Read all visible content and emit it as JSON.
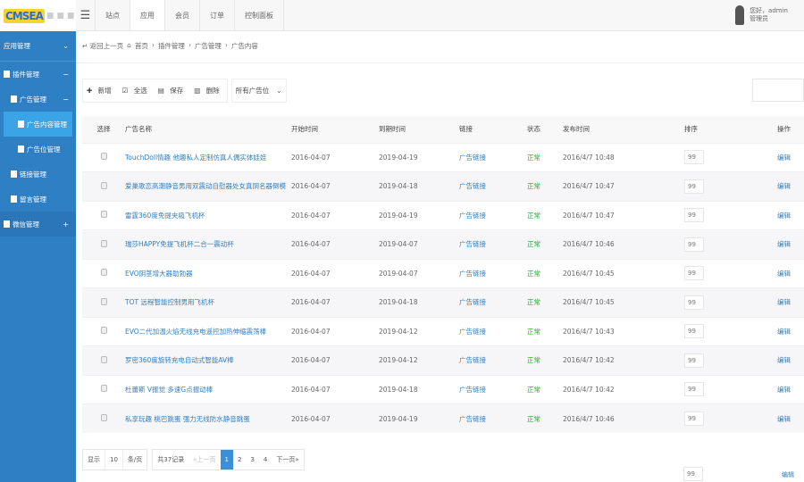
{
  "logo": "CMSEA",
  "topnav": {
    "items": [
      "站点",
      "应用",
      "会员",
      "订单",
      "控制面板"
    ],
    "active": 1
  },
  "user": {
    "greeting": "您好，admin",
    "role": "管理员"
  },
  "sidebar": {
    "items": [
      {
        "label": "应用管理",
        "icon": "chevron-down"
      },
      {
        "label": "插件管理",
        "icon": "minus"
      },
      {
        "label": "广告管理",
        "icon": "minus"
      },
      {
        "label": "广告内容管理"
      },
      {
        "label": "广告位管理"
      },
      {
        "label": "链接管理"
      },
      {
        "label": "留言管理"
      },
      {
        "label": "微信管理",
        "icon": "plus"
      }
    ]
  },
  "breadcrumb": {
    "back": "返回上一页",
    "items": [
      "首页",
      "插件管理",
      "广告管理",
      "广告内容"
    ]
  },
  "toolbar": {
    "add": "新增",
    "select_all": "全选",
    "save": "保存",
    "delete": "删除",
    "position_select": "所有广告位"
  },
  "table": {
    "headers": [
      "选择",
      "广告名称",
      "开始时间",
      "到期时间",
      "链接",
      "状态",
      "发布时间",
      "排序",
      "操作"
    ],
    "rows": [
      {
        "name": "TouchDoll情趣 他趣私人定制仿真人偶实体娃娃",
        "start": "2016-04-07",
        "end": "2019-04-19",
        "link": "广告链接",
        "status": "正常",
        "published": "2016/4/7 10:48",
        "order": "99",
        "action": "编辑"
      },
      {
        "name": "爱巢歌恋高潮静音男用双震动自慰器处女真阴名器倒模",
        "start": "2016-04-07",
        "end": "2019-04-18",
        "link": "广告链接",
        "status": "正常",
        "published": "2016/4/7 10:47",
        "order": "99",
        "action": "编辑"
      },
      {
        "name": "雷霆360度免提夹吸飞机杯",
        "start": "2016-04-07",
        "end": "2019-04-19",
        "link": "广告链接",
        "status": "正常",
        "published": "2016/4/7 10:47",
        "order": "99",
        "action": "编辑"
      },
      {
        "name": "瑞莎HAPPY免提飞机杯二合一震动杯",
        "start": "2016-04-07",
        "end": "2019-04-07",
        "link": "广告链接",
        "status": "正常",
        "published": "2016/4/7 10:46",
        "order": "99",
        "action": "编辑"
      },
      {
        "name": "EVO阴茎增大器助勃器",
        "start": "2016-04-07",
        "end": "2019-04-07",
        "link": "广告链接",
        "status": "正常",
        "published": "2016/4/7 10:45",
        "order": "99",
        "action": "编辑"
      },
      {
        "name": "TOT 远程智能控制男用飞机杯",
        "start": "2016-04-07",
        "end": "2019-04-18",
        "link": "广告链接",
        "status": "正常",
        "published": "2016/4/7 10:45",
        "order": "99",
        "action": "编辑"
      },
      {
        "name": "EVO二代加温火焰无线充电遥控加热伸缩震荡棒",
        "start": "2016-04-07",
        "end": "2019-04-12",
        "link": "广告链接",
        "status": "正常",
        "published": "2016/4/7 10:43",
        "order": "99",
        "action": "编辑"
      },
      {
        "name": "罗密360度旋转充电自动式智能AV棒",
        "start": "2016-04-07",
        "end": "2019-04-12",
        "link": "广告链接",
        "status": "正常",
        "published": "2016/4/7 10:42",
        "order": "99",
        "action": "编辑"
      },
      {
        "name": "杜蕾斯 V振觉 多速G点振动棒",
        "start": "2016-04-07",
        "end": "2019-04-18",
        "link": "广告链接",
        "status": "正常",
        "published": "2016/4/7 10:42",
        "order": "99",
        "action": "编辑"
      },
      {
        "name": "私享玩趣 桃巴跳蛋 强力无线防水静音跳蛋",
        "start": "2016-04-07",
        "end": "2019-04-19",
        "link": "广告链接",
        "status": "正常",
        "published": "2016/4/7 10:46",
        "order": "99",
        "action": "编辑"
      }
    ],
    "extra_row": {
      "order": "99",
      "action": "编辑"
    }
  },
  "pagination": {
    "show": "显示",
    "per_page": "10",
    "per_page_unit": "条/页",
    "total": "共37记录",
    "prev": "«上一页",
    "pages": [
      "1",
      "2",
      "3",
      "4"
    ],
    "current": "1",
    "next": "下一页»"
  }
}
